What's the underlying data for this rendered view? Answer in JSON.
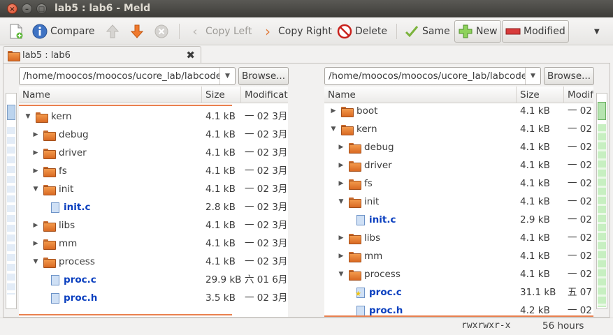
{
  "window": {
    "title": "lab5 : lab6 - Meld"
  },
  "toolbar": {
    "compare": "Compare",
    "copy_left": "Copy Left",
    "copy_right": "Copy Right",
    "delete": "Delete",
    "same": "Same",
    "new": "New",
    "modified": "Modified"
  },
  "tab": {
    "label": "lab5 : lab6"
  },
  "left": {
    "path": "/home/moocos/moocos/ucore_lab/labcodes",
    "browse": "Browse...",
    "columns": {
      "name": "Name",
      "size": "Size",
      "modified": "Modificat"
    },
    "rows": [
      {
        "name": "kern",
        "type": "folder",
        "tri": "▼",
        "depth": 0,
        "size": "4.1 kB",
        "mod": "一 02  3月"
      },
      {
        "name": "debug",
        "type": "folder",
        "tri": "▶",
        "depth": 1,
        "size": "4.1 kB",
        "mod": "一 02  3月"
      },
      {
        "name": "driver",
        "type": "folder",
        "tri": "▶",
        "depth": 1,
        "size": "4.1 kB",
        "mod": "一 02  3月"
      },
      {
        "name": "fs",
        "type": "folder",
        "tri": "▶",
        "depth": 1,
        "size": "4.1 kB",
        "mod": "一 02  3月"
      },
      {
        "name": "init",
        "type": "folder",
        "tri": "▼",
        "depth": 1,
        "size": "4.1 kB",
        "mod": "一 02  3月"
      },
      {
        "name": "init.c",
        "type": "file",
        "tri": "",
        "depth": 2,
        "size": "2.8 kB",
        "mod": "一 02  3月",
        "modified": true
      },
      {
        "name": "libs",
        "type": "folder",
        "tri": "▶",
        "depth": 1,
        "size": "4.1 kB",
        "mod": "一 02  3月"
      },
      {
        "name": "mm",
        "type": "folder",
        "tri": "▶",
        "depth": 1,
        "size": "4.1 kB",
        "mod": "一 02  3月"
      },
      {
        "name": "process",
        "type": "folder",
        "tri": "▼",
        "depth": 1,
        "size": "4.1 kB",
        "mod": "一 02  3月"
      },
      {
        "name": "proc.c",
        "type": "file",
        "tri": "",
        "depth": 2,
        "size": "29.9 kB",
        "mod": "六 01  6月",
        "modified": true
      },
      {
        "name": "proc.h",
        "type": "file",
        "tri": "",
        "depth": 2,
        "size": "3.5 kB",
        "mod": "一 02  3月",
        "modified": true
      }
    ]
  },
  "right": {
    "path": "/home/moocos/moocos/ucore_lab/labcodes",
    "browse": "Browse...",
    "columns": {
      "name": "Name",
      "size": "Size",
      "modified": "Modif"
    },
    "rows": [
      {
        "name": "boot",
        "type": "folder",
        "tri": "▶",
        "depth": 0,
        "size": "4.1 kB",
        "mod": "一 02"
      },
      {
        "name": "kern",
        "type": "folder",
        "tri": "▼",
        "depth": 0,
        "size": "4.1 kB",
        "mod": "一 02"
      },
      {
        "name": "debug",
        "type": "folder",
        "tri": "▶",
        "depth": 1,
        "size": "4.1 kB",
        "mod": "一 02"
      },
      {
        "name": "driver",
        "type": "folder",
        "tri": "▶",
        "depth": 1,
        "size": "4.1 kB",
        "mod": "一 02"
      },
      {
        "name": "fs",
        "type": "folder",
        "tri": "▶",
        "depth": 1,
        "size": "4.1 kB",
        "mod": "一 02"
      },
      {
        "name": "init",
        "type": "folder",
        "tri": "▼",
        "depth": 1,
        "size": "4.1 kB",
        "mod": "一 02"
      },
      {
        "name": "init.c",
        "type": "file",
        "tri": "",
        "depth": 2,
        "size": "2.9 kB",
        "mod": "一 02",
        "modified": true
      },
      {
        "name": "libs",
        "type": "folder",
        "tri": "▶",
        "depth": 1,
        "size": "4.1 kB",
        "mod": "一 02"
      },
      {
        "name": "mm",
        "type": "folder",
        "tri": "▶",
        "depth": 1,
        "size": "4.1 kB",
        "mod": "一 02"
      },
      {
        "name": "process",
        "type": "folder",
        "tri": "▼",
        "depth": 1,
        "size": "4.1 kB",
        "mod": "一 02"
      },
      {
        "name": "proc.c",
        "type": "file",
        "tri": "",
        "depth": 2,
        "size": "31.1 kB",
        "mod": "五 07",
        "modified": true,
        "star": true
      },
      {
        "name": "proc.h",
        "type": "file",
        "tri": "",
        "depth": 2,
        "size": "4.2 kB",
        "mod": "一 02",
        "modified": true
      }
    ]
  },
  "status": {
    "perms": "rwxrwxr-x",
    "age": "56 hours"
  },
  "colors": {
    "accent_orange": "#e9804f",
    "modified_blue": "#0a3fbf",
    "new_green": "#9fe09a"
  }
}
